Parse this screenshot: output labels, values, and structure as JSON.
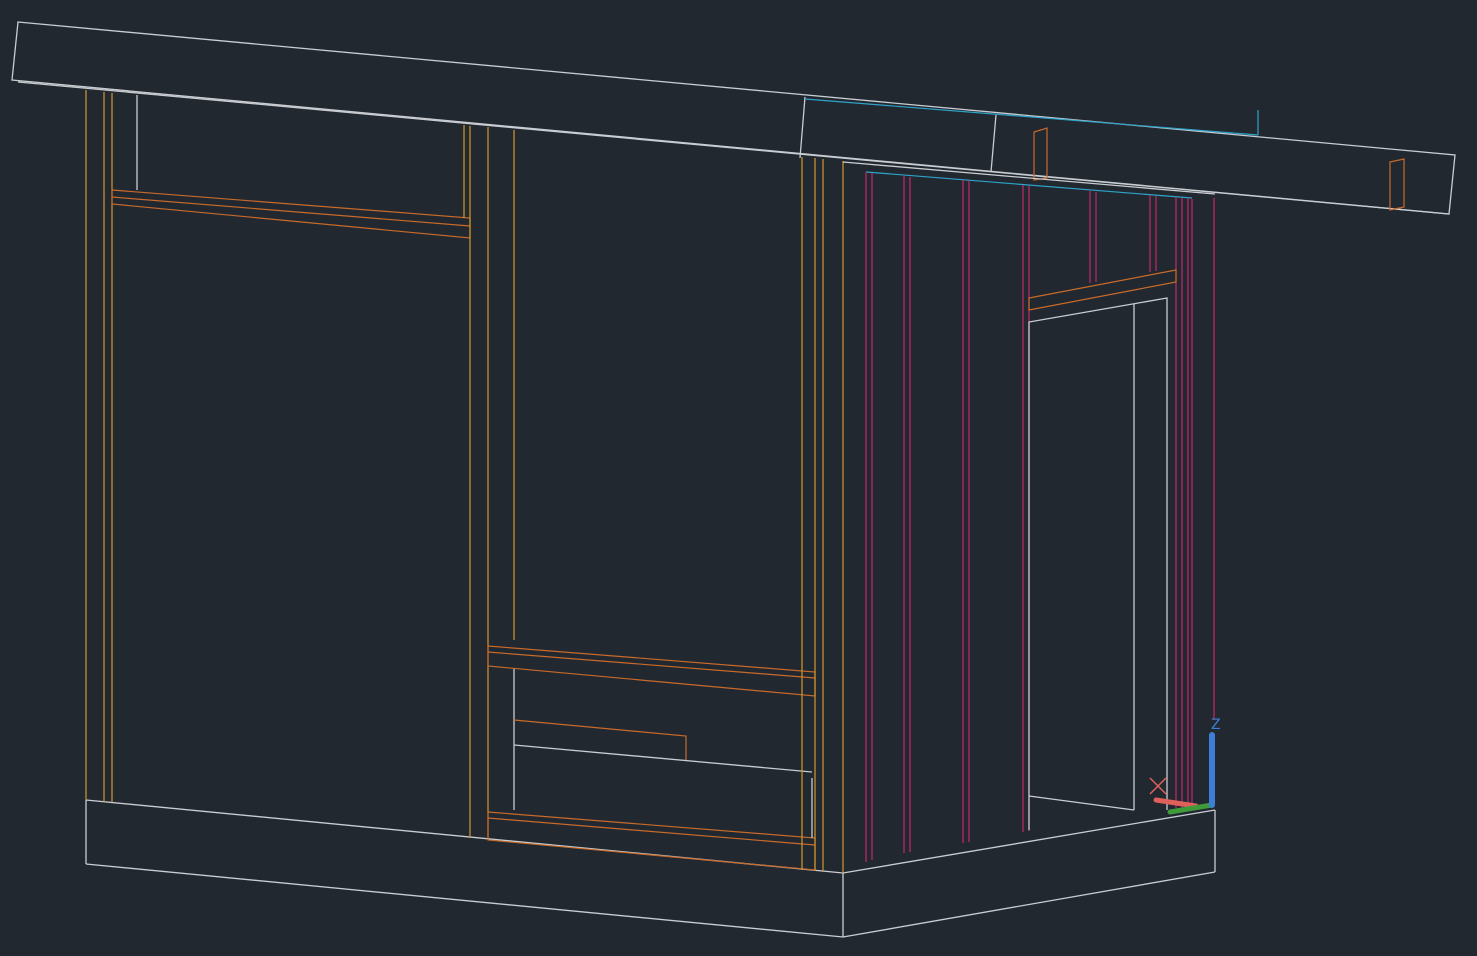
{
  "app": {
    "view_mode": "3D wireframe",
    "background": "#212830"
  },
  "colors": {
    "edge": "#c9cdd2",
    "orange": "#c86a2a",
    "yellow": "#d39a2c",
    "magenta": "#c2276f",
    "cyan": "#2fa3c9",
    "axis_x": "#e0605c",
    "axis_y": "#3f9a3a",
    "axis_z": "#3d7fd6"
  },
  "icons": {
    "ucs": "ucs-axis-gizmo-icon",
    "x_marker": "x-cross-icon"
  },
  "ucs": {
    "z_label": "Z"
  }
}
